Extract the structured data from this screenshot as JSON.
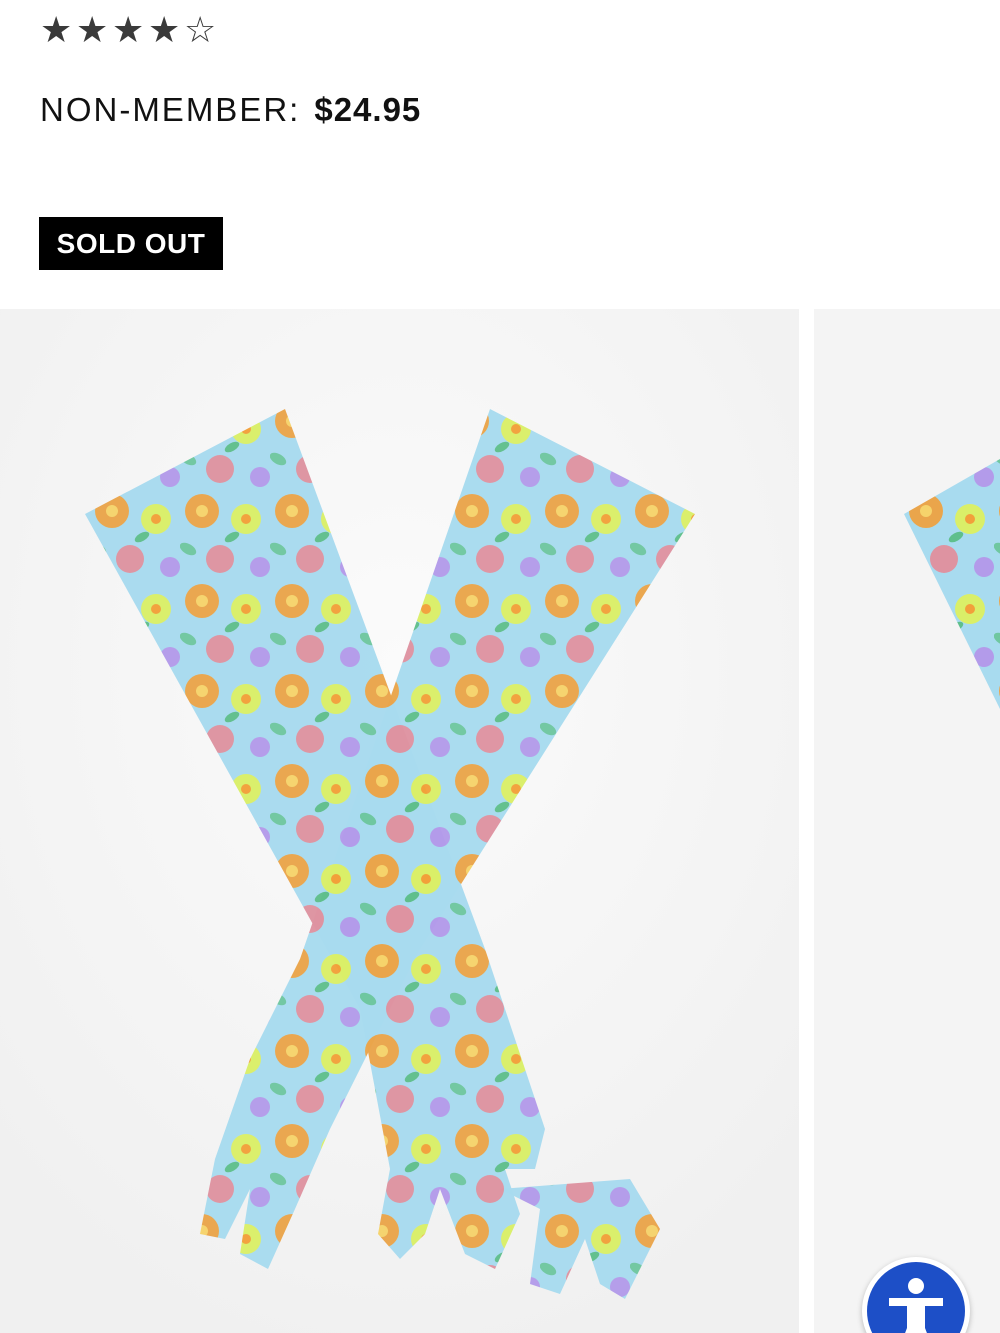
{
  "product": {
    "rating": {
      "value": 4,
      "max": 5,
      "stars": [
        "★",
        "★",
        "★",
        "★",
        "☆"
      ]
    },
    "price_label": "NON-MEMBER:",
    "price_value": "$24.95",
    "status_badge": "SOLD OUT"
  },
  "gallery": {
    "images": [
      {
        "subject": "floral mesh opera gloves crossed",
        "colors": [
          "#9fd7ef",
          "#f2a03a",
          "#e0f25a",
          "#6fc7a0",
          "#b58be8",
          "#f07a86"
        ]
      },
      {
        "subject": "floral mesh opera gloves (partial next slide)"
      }
    ]
  },
  "accessibility": {
    "icon": "accessibility-person-icon",
    "color": "#1d4fc7"
  }
}
